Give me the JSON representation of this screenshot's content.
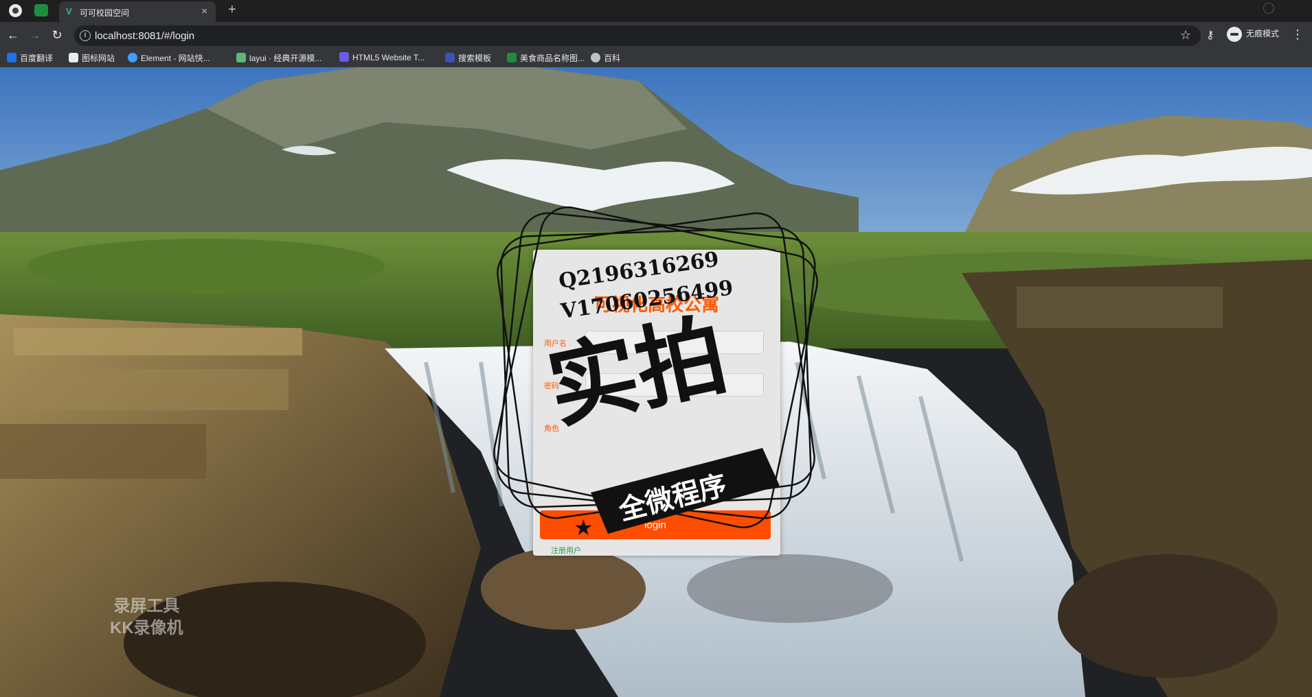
{
  "browser": {
    "tab_title": "可可校园空间",
    "url": "localhost:8081/#/login",
    "incognito_label": "无痕模式",
    "new_tab_symbol": "+",
    "close_symbol": "×",
    "bookmarks": [
      {
        "label": "百度翻译",
        "color": "#1a73e8"
      },
      {
        "label": "图标网站",
        "color": "#e8eaed"
      },
      {
        "label": "Element - 网站快...",
        "color": "#409eff"
      },
      {
        "label": "layui · 经典开源模...",
        "color": "#5fb878"
      },
      {
        "label": "HTML5 Website T...",
        "color": "#6c5ce7"
      },
      {
        "label": "搜索模板",
        "color": "#3f51b5"
      },
      {
        "label": "美食商品名称图...",
        "color": "#1e8e3e"
      },
      {
        "label": "百科",
        "color": "#bdc1c6"
      }
    ]
  },
  "login": {
    "title": "可视化高校公寓",
    "username_label": "用户名",
    "password_label": "密码",
    "role_label": "角色",
    "button_label": "login",
    "register_link": "注册用户"
  },
  "watermark": {
    "contact_q": "Q2196316269",
    "contact_v": "V17060256499",
    "big_text": "实拍",
    "banner_text": "全微程序",
    "recorder_line1": "录屏工具",
    "recorder_line2": "KK录像机"
  },
  "colors": {
    "accent": "#ff4d00",
    "sky": "#4f84c7",
    "water": "#e8eef2"
  }
}
